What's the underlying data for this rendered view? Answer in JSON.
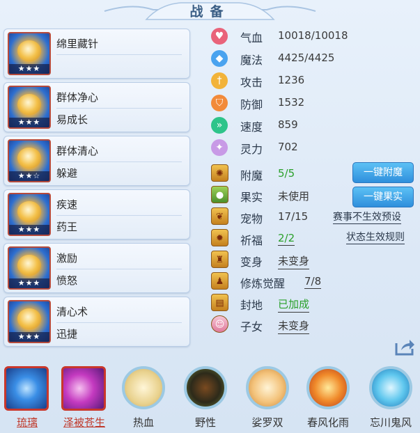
{
  "title": "战备",
  "cards": [
    {
      "line1": "绵里藏针",
      "line2": "",
      "stars": "★★★"
    },
    {
      "line1": "群体净心",
      "line2": "易成长",
      "stars": "★★★"
    },
    {
      "line1": "群体清心",
      "line2": "躲避",
      "stars": "★★☆"
    },
    {
      "line1": "疾速",
      "line2": "药王",
      "stars": "★★★"
    },
    {
      "line1": "激励",
      "line2": "愤怒",
      "stars": "★★★"
    },
    {
      "line1": "清心术",
      "line2": "迅捷",
      "stars": "★★★"
    }
  ],
  "stats": [
    {
      "label": "气血",
      "value": "10018/10018",
      "icon": "heart-icon",
      "color": "#e9637a"
    },
    {
      "label": "魔法",
      "value": "4425/4425",
      "icon": "magic-icon",
      "color": "#4aa3ef"
    },
    {
      "label": "攻击",
      "value": "1236",
      "icon": "attack-icon",
      "color": "#f2b33a"
    },
    {
      "label": "防御",
      "value": "1532",
      "icon": "defense-icon",
      "color": "#f28a3a"
    },
    {
      "label": "速度",
      "value": "859",
      "icon": "speed-icon",
      "color": "#2ec48a"
    },
    {
      "label": "灵力",
      "value": "702",
      "icon": "spirit-icon",
      "color": "#c89ae6"
    }
  ],
  "rows": [
    {
      "label": "附魔",
      "value": "5/5",
      "icon": "enchant-icon",
      "style": "green"
    },
    {
      "label": "果实",
      "value": "未使用",
      "icon": "fruit-icon",
      "style": ""
    },
    {
      "label": "宠物",
      "value": "17/15",
      "icon": "pet-icon",
      "style": ""
    },
    {
      "label": "祈福",
      "value": "2/2",
      "icon": "blessing-icon",
      "style": "green ul"
    },
    {
      "label": "变身",
      "value": "未变身",
      "icon": "transform-icon",
      "style": "ul"
    },
    {
      "label": "修炼觉醒",
      "value": "7/8",
      "icon": "cultivation-icon",
      "style": "ul"
    },
    {
      "label": "封地",
      "value": "已加成",
      "icon": "fief-icon",
      "style": "green ul"
    },
    {
      "label": "子女",
      "value": "未变身",
      "icon": "child-icon",
      "style": "ul"
    }
  ],
  "buttons": {
    "enchant": "一键附魔",
    "fruit": "一键果实"
  },
  "links": {
    "preset": "赛事不生效预设",
    "rules": "状态生效规则"
  },
  "skills": [
    {
      "label": "琉璃",
      "frame": "square",
      "red": true
    },
    {
      "label": "泽被苍生",
      "frame": "square",
      "red": true
    },
    {
      "label": "热血",
      "frame": "ring",
      "red": false
    },
    {
      "label": "野性",
      "frame": "ring",
      "red": false
    },
    {
      "label": "娑罗双",
      "frame": "ring",
      "red": false
    },
    {
      "label": "春风化雨",
      "frame": "ring",
      "red": false
    },
    {
      "label": "忘川鬼风",
      "frame": "ring",
      "red": false
    }
  ]
}
